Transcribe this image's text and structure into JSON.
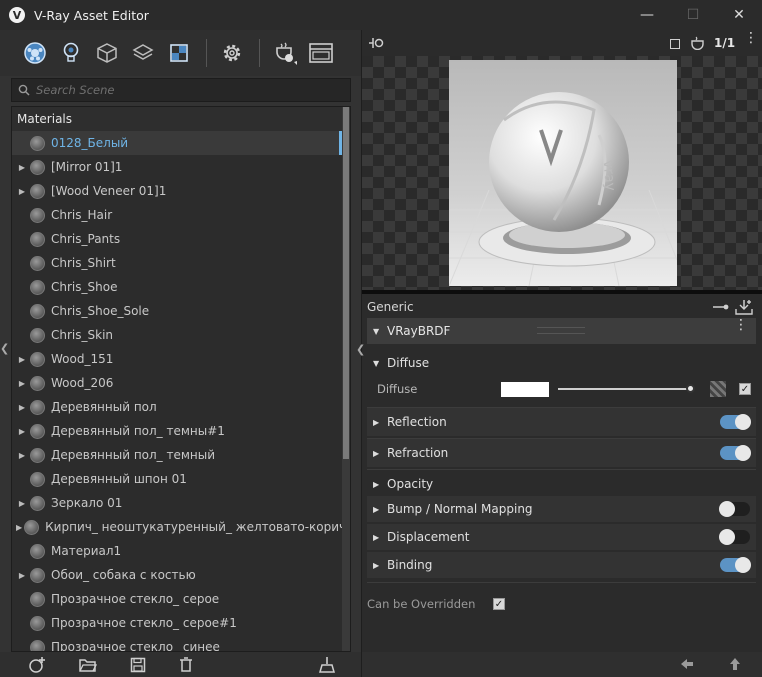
{
  "window": {
    "title": "V-Ray Asset Editor",
    "minimize": "—",
    "maximize": "☐",
    "close": "✕"
  },
  "toolbar": {
    "icons": [
      "materials-icon",
      "lights-icon",
      "geometry-icon",
      "layers-icon",
      "render-elements-icon",
      "settings-icon",
      "render-icon",
      "frame-buffer-icon"
    ]
  },
  "search": {
    "placeholder": "Search Scene"
  },
  "materials": {
    "header": "Materials",
    "items": [
      {
        "label": "0128_Белый",
        "expandable": false,
        "selected": true
      },
      {
        "label": "[Mirror 01]1",
        "expandable": true,
        "selected": false
      },
      {
        "label": "[Wood Veneer 01]1",
        "expandable": true,
        "selected": false
      },
      {
        "label": "Chris_Hair",
        "expandable": false,
        "selected": false
      },
      {
        "label": "Chris_Pants",
        "expandable": false,
        "selected": false
      },
      {
        "label": "Chris_Shirt",
        "expandable": false,
        "selected": false
      },
      {
        "label": "Chris_Shoe",
        "expandable": false,
        "selected": false
      },
      {
        "label": "Chris_Shoe_Sole",
        "expandable": false,
        "selected": false
      },
      {
        "label": "Chris_Skin",
        "expandable": false,
        "selected": false
      },
      {
        "label": "Wood_151",
        "expandable": true,
        "selected": false
      },
      {
        "label": "Wood_206",
        "expandable": true,
        "selected": false
      },
      {
        "label": "Деревянный пол",
        "expandable": true,
        "selected": false
      },
      {
        "label": "Деревянный пол_ темны#1",
        "expandable": true,
        "selected": false
      },
      {
        "label": "Деревянный пол_ темный",
        "expandable": true,
        "selected": false
      },
      {
        "label": "Деревянный шпон 01",
        "expandable": false,
        "selected": false
      },
      {
        "label": "Зеркало 01",
        "expandable": true,
        "selected": false
      },
      {
        "label": "Кирпич_ неоштукатуренный_ желтовато-коричне…",
        "expandable": true,
        "selected": false
      },
      {
        "label": "Материал1",
        "expandable": false,
        "selected": false
      },
      {
        "label": "Обои_ собака с костью",
        "expandable": true,
        "selected": false
      },
      {
        "label": "Прозрачное стекло_ серое",
        "expandable": false,
        "selected": false
      },
      {
        "label": "Прозрачное стекло_ серое#1",
        "expandable": false,
        "selected": false
      },
      {
        "label": "Прозрачное стекло_ синее",
        "expandable": false,
        "selected": false
      }
    ]
  },
  "preview": {
    "ratio": "1/1"
  },
  "editor": {
    "generic_label": "Generic",
    "brdf_label": "VRayBRDF",
    "sections": {
      "diffuse": "Diffuse",
      "diffuse_param": "Diffuse",
      "reflection": "Reflection",
      "refraction": "Refraction",
      "opacity": "Opacity",
      "bump": "Bump / Normal Mapping",
      "displacement": "Displacement",
      "binding": "Binding"
    },
    "toggles": {
      "reflection": true,
      "refraction": true,
      "bump": false,
      "displacement": false,
      "binding": true
    },
    "diffuse_color": "#ffffff",
    "diffuse_amount": 1.0,
    "can_be_overridden_label": "Can be Overridden",
    "can_be_overridden": true
  },
  "colors": {
    "accent": "#5c93c4",
    "selected_text": "#6fb4e6"
  }
}
